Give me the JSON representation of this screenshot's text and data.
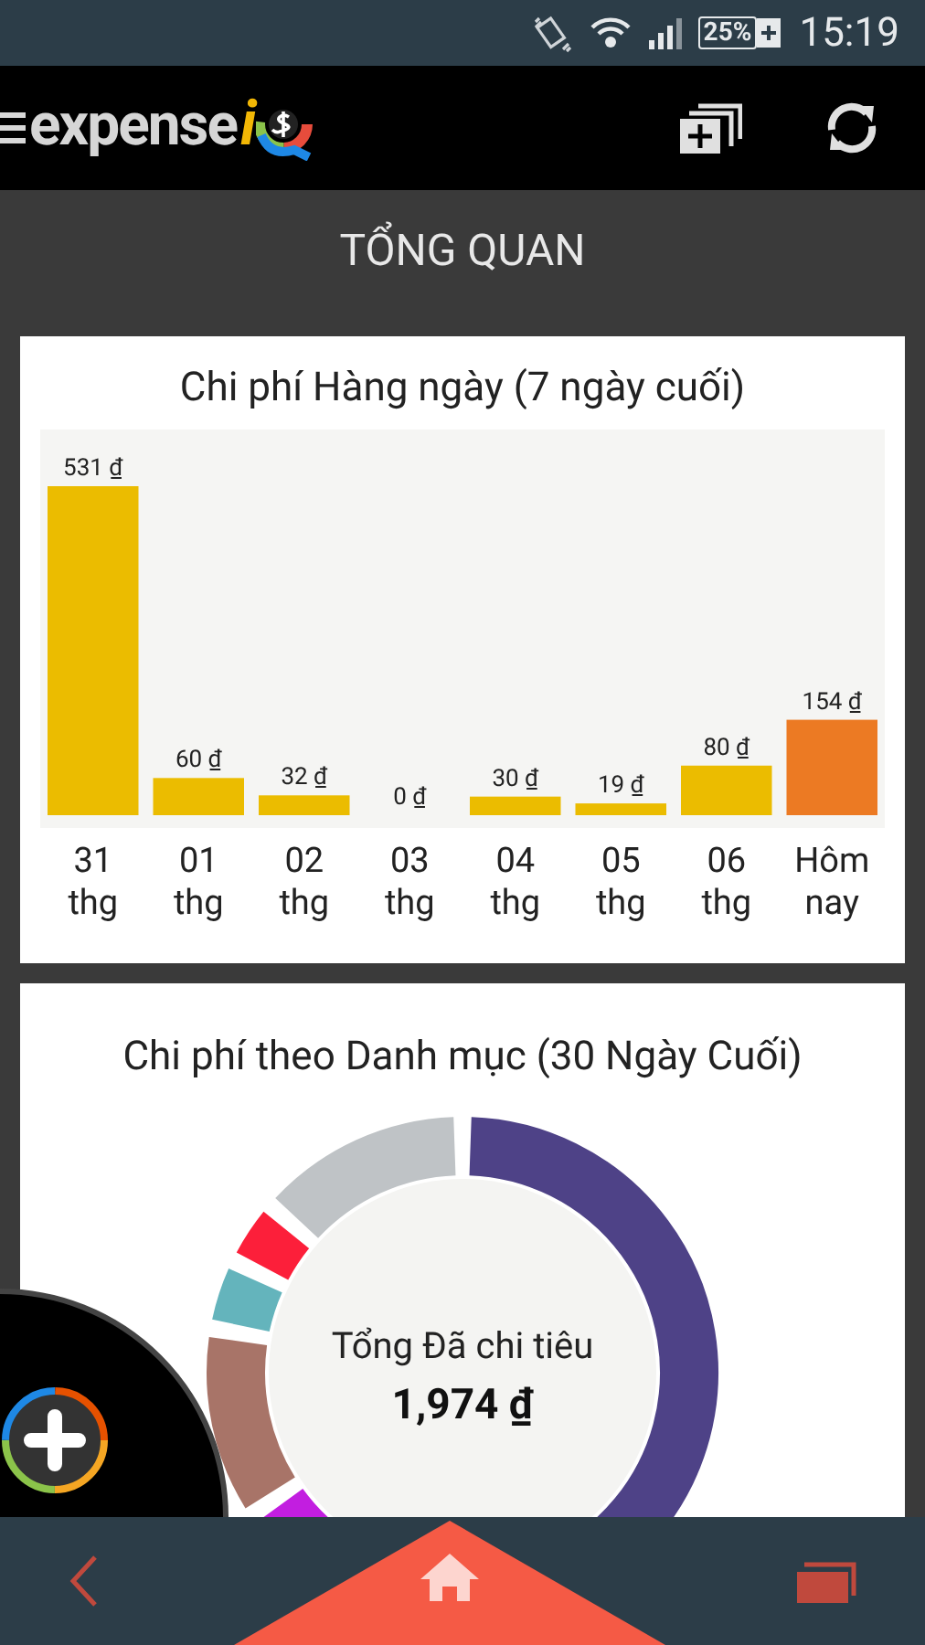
{
  "status_bar": {
    "battery": "25%",
    "time": "15:19"
  },
  "app_bar": {
    "logo_text": "expense",
    "logo_letter": "i"
  },
  "page_title": "TỔNG QUAN",
  "daily_card": {
    "title": "Chi phí Hàng ngày (7 ngày cuối)",
    "chart_data": {
      "type": "bar",
      "stacked": true,
      "categories": [
        "31 thg",
        "01 thg",
        "02 thg",
        "03 thg",
        "04 thg",
        "05 thg",
        "06 thg",
        "Hôm nay"
      ],
      "series": [
        {
          "color": "#ebbc00",
          "values": [
            531,
            60,
            32,
            0,
            30,
            19,
            80,
            null
          ],
          "value_labels": [
            "531 ₫",
            "60 ₫",
            "32 ₫",
            "0 ₫",
            "30 ₫",
            "19 ₫",
            "80 ₫",
            null
          ]
        },
        {
          "color": "#ec7a23",
          "values": [
            null,
            null,
            null,
            null,
            null,
            null,
            null,
            154
          ],
          "value_labels": [
            null,
            null,
            null,
            null,
            null,
            null,
            null,
            "154 ₫"
          ]
        }
      ]
    }
  },
  "category_card": {
    "title": "Chi phí theo Danh mục (30 Ngày Cuối)",
    "center_label": "Tổng Đã chi tiêu",
    "total": "1,974 ₫"
  }
}
